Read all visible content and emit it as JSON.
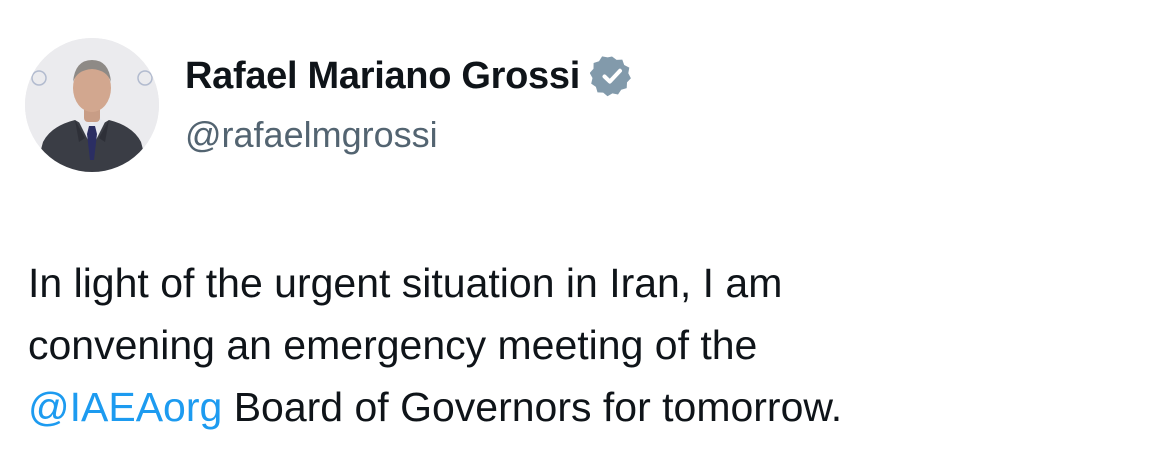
{
  "author": {
    "display_name": "Rafael Mariano Grossi",
    "handle": "@rafaelmgrossi",
    "verified_icon": "verified-badge-icon",
    "avatar": "avatar"
  },
  "tweet": {
    "line1": "In light of the urgent situation in Iran, I am",
    "line2": "convening an emergency meeting of the",
    "mention": "@IAEAorg",
    "line3_rest": " Board of Governors for tomorrow."
  },
  "colors": {
    "text": "#0f1419",
    "secondary_text": "#536471",
    "link": "#1d9bf0",
    "verified_badge": "#829aab",
    "background": "#ffffff"
  }
}
